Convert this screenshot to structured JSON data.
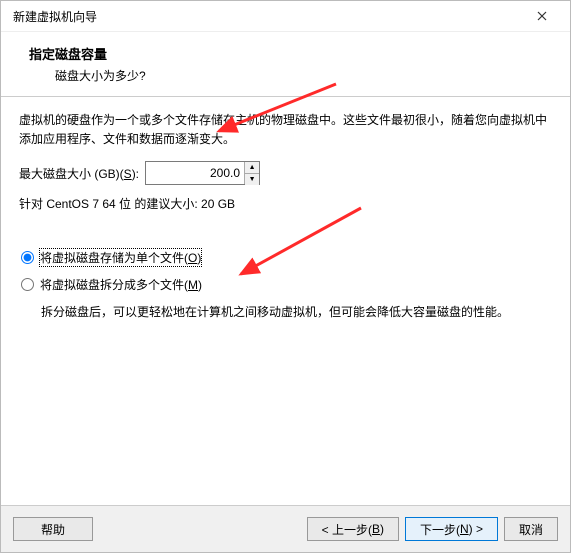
{
  "window": {
    "title": "新建虚拟机向导"
  },
  "header": {
    "title": "指定磁盘容量",
    "subtitle": "磁盘大小为多少?"
  },
  "description": "虚拟机的硬盘作为一个或多个文件存储在主机的物理磁盘中。这些文件最初很小，随着您向虚拟机中添加应用程序、文件和数据而逐渐变大。",
  "size": {
    "label_prefix": "最大磁盘大小 (GB)(",
    "label_key": "S",
    "label_suffix": "):",
    "value": "200.0"
  },
  "recommend": "针对 CentOS 7 64 位 的建议大小: 20 GB",
  "options": {
    "single": {
      "prefix": "将虚拟磁盘存储为单个文件(",
      "key": "O",
      "suffix": ")"
    },
    "split": {
      "prefix": "将虚拟磁盘拆分成多个文件(",
      "key": "M",
      "suffix": ")"
    },
    "split_hint": "拆分磁盘后，可以更轻松地在计算机之间移动虚拟机，但可能会降低大容量磁盘的性能。"
  },
  "buttons": {
    "help": "帮助",
    "back_prefix": "< 上一步(",
    "back_key": "B",
    "back_suffix": ")",
    "next_prefix": "下一步(",
    "next_key": "N",
    "next_suffix": ") >",
    "cancel": "取消"
  }
}
